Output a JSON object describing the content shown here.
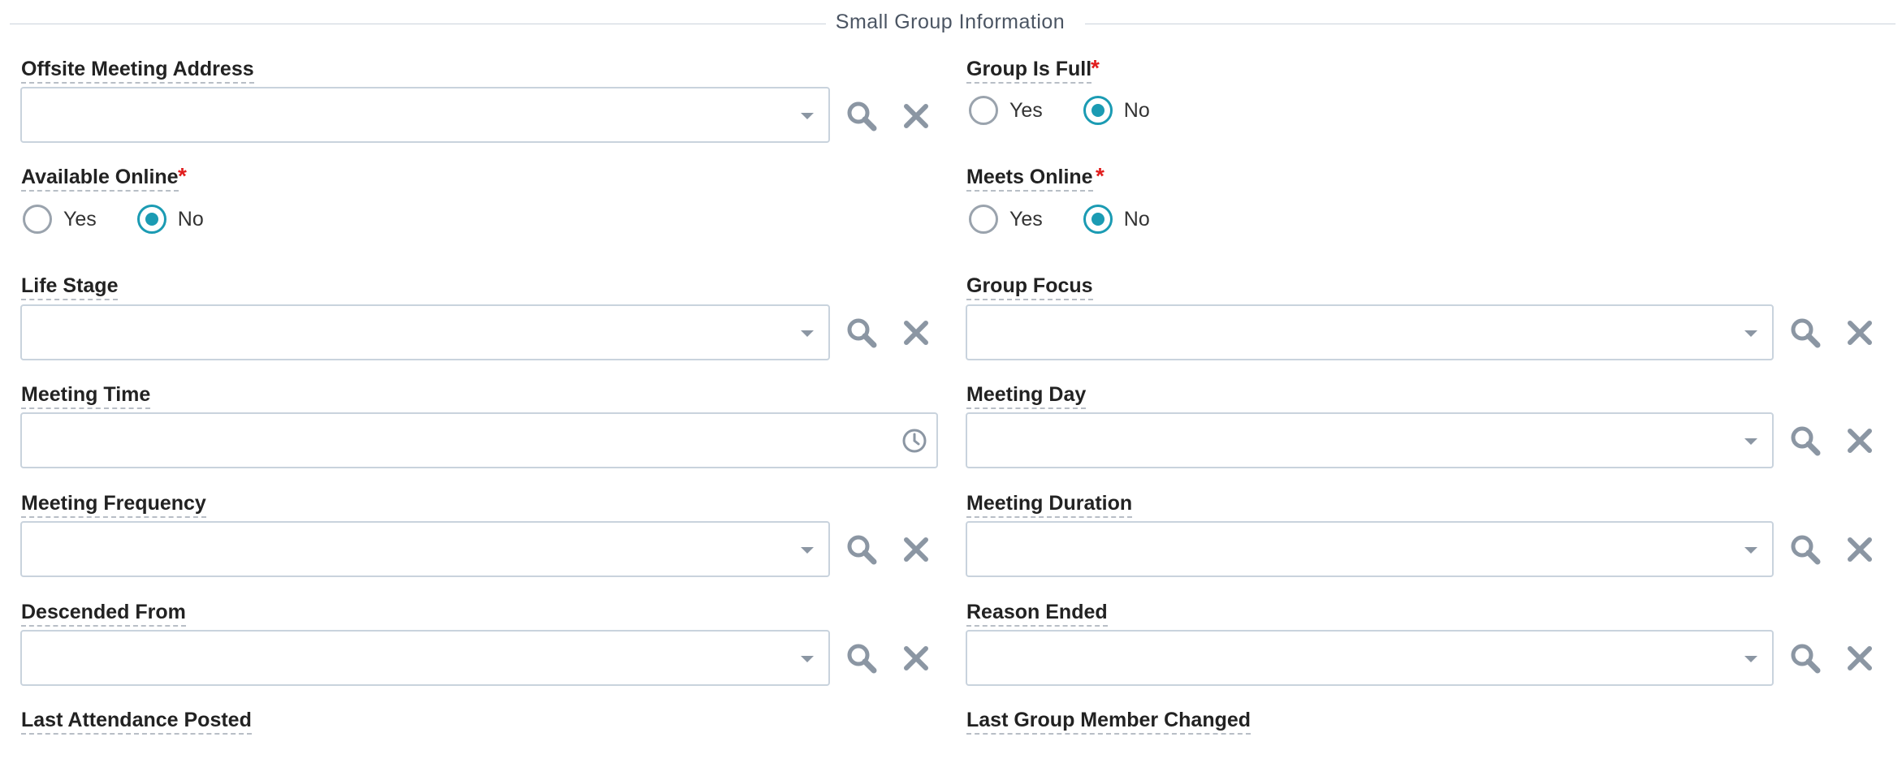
{
  "section": {
    "title": "Small Group Information"
  },
  "fields": {
    "offsite_meeting_address": {
      "label": "Offsite Meeting Address",
      "value": ""
    },
    "group_is_full": {
      "label": "Group Is Full",
      "required_mark": "*",
      "options": [
        "Yes",
        "No"
      ],
      "selected": "No"
    },
    "available_online": {
      "label": "Available Online",
      "required_mark": "*",
      "options": [
        "Yes",
        "No"
      ],
      "selected": "No"
    },
    "meets_online": {
      "label": "Meets Online",
      "required_mark": "*",
      "options": [
        "Yes",
        "No"
      ],
      "selected": "No"
    },
    "life_stage": {
      "label": "Life Stage",
      "value": ""
    },
    "group_focus": {
      "label": "Group Focus",
      "value": ""
    },
    "meeting_time": {
      "label": "Meeting Time",
      "value": ""
    },
    "meeting_day": {
      "label": "Meeting Day",
      "value": ""
    },
    "meeting_frequency": {
      "label": "Meeting Frequency",
      "value": ""
    },
    "meeting_duration": {
      "label": "Meeting Duration",
      "value": ""
    },
    "descended_from": {
      "label": "Descended From",
      "value": ""
    },
    "reason_ended": {
      "label": "Reason Ended",
      "value": ""
    },
    "last_attendance_posted": {
      "label": "Last Attendance Posted"
    },
    "last_group_member_changed": {
      "label": "Last Group Member Changed"
    }
  },
  "colors": {
    "accent": "#1b9bb3",
    "required": "#e11d1d",
    "icon": "#8b96a3",
    "border": "#c9d3dd"
  },
  "icons": {
    "lookup": "search-icon",
    "clear": "close-icon",
    "dropdown": "chevron-down-icon",
    "time": "clock-icon"
  }
}
